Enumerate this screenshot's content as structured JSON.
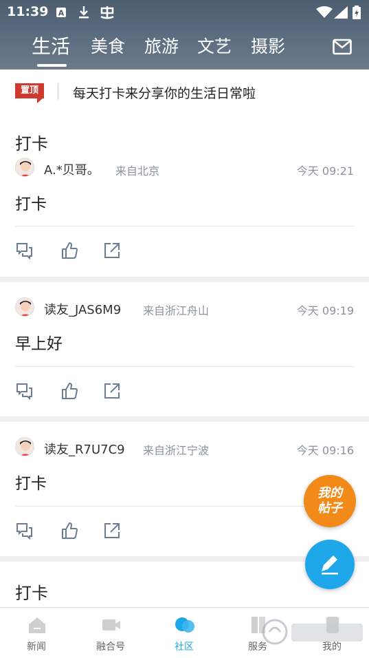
{
  "status_bar": {
    "time": "11:39"
  },
  "tabs": [
    {
      "label": "生活",
      "active": true
    },
    {
      "label": "美食"
    },
    {
      "label": "旅游"
    },
    {
      "label": "文艺"
    },
    {
      "label": "摄影"
    }
  ],
  "pinned": {
    "badge": "置顶",
    "text": "每天打卡来分享你的生活日常啦"
  },
  "posts": [
    {
      "title": "打卡",
      "user": "A.*贝哥。",
      "from": "来自北京",
      "time": "今天 09:21",
      "content": "打卡"
    },
    {
      "user": "读友_JAS6M9",
      "from": "来自浙江舟山",
      "time": "今天 09:19",
      "content": "早上好"
    },
    {
      "user": "读友_R7U7C9",
      "from": "来自浙江宁波",
      "time": "今天 09:16",
      "content": "打卡"
    },
    {
      "title": "打卡"
    }
  ],
  "fab": {
    "mine_line1": "我的",
    "mine_line2": "帖子"
  },
  "bottom_nav": [
    {
      "label": "新闻"
    },
    {
      "label": "融合号"
    },
    {
      "label": "社区",
      "active": true
    },
    {
      "label": "服务"
    },
    {
      "label": "我的"
    }
  ],
  "colors": {
    "accent": "#1ea7e8",
    "fab_orange": "#f28a1a",
    "pin_red": "#cf3a2f",
    "header": "#56677a"
  }
}
